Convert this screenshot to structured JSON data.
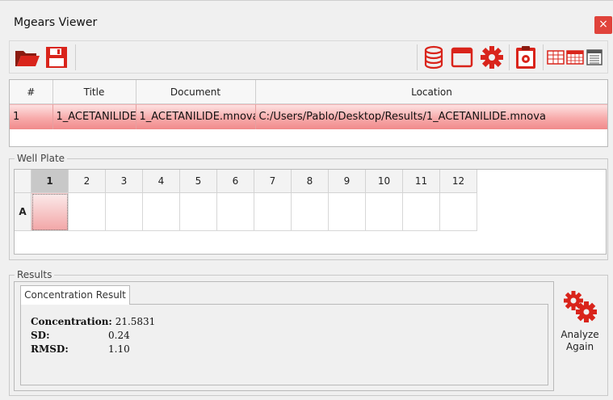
{
  "window": {
    "title": "Mgears Viewer",
    "close_label": "×"
  },
  "toolbar": {
    "icons": [
      "open-folder-icon",
      "save-icon",
      "database-icon",
      "window-icon",
      "settings-gear-icon",
      "clipboard-settings-icon",
      "table-view-icon",
      "grid-view-icon",
      "list-view-icon"
    ]
  },
  "results_table": {
    "headers": [
      "#",
      "Title",
      "Document",
      "Location"
    ],
    "rows": [
      {
        "num": "1",
        "title": "1_ACETANILIDE",
        "document": "1_ACETANILIDE.mnova",
        "location": "C:/Users/Pablo/Desktop/Results/1_ACETANILIDE.mnova"
      }
    ]
  },
  "well_plate": {
    "label": "Well Plate",
    "columns": [
      "1",
      "2",
      "3",
      "4",
      "5",
      "6",
      "7",
      "8",
      "9",
      "10",
      "11",
      "12"
    ],
    "rows": [
      "A"
    ],
    "selected_column": "1"
  },
  "results": {
    "label": "Results",
    "tab_label": "Concentration Result",
    "concentration_label": "Concentration:",
    "concentration_value": "21.5831",
    "sd_label": "SD:",
    "sd_value": "0.24",
    "rmsd_label": "RMSD:",
    "rmsd_value": "1.10",
    "analyze_label_1": "Analyze",
    "analyze_label_2": "Again"
  },
  "colors": {
    "accent_red": "#d9241b",
    "selection_pink": "#f7aaaa",
    "close_red": "#e0433b"
  }
}
